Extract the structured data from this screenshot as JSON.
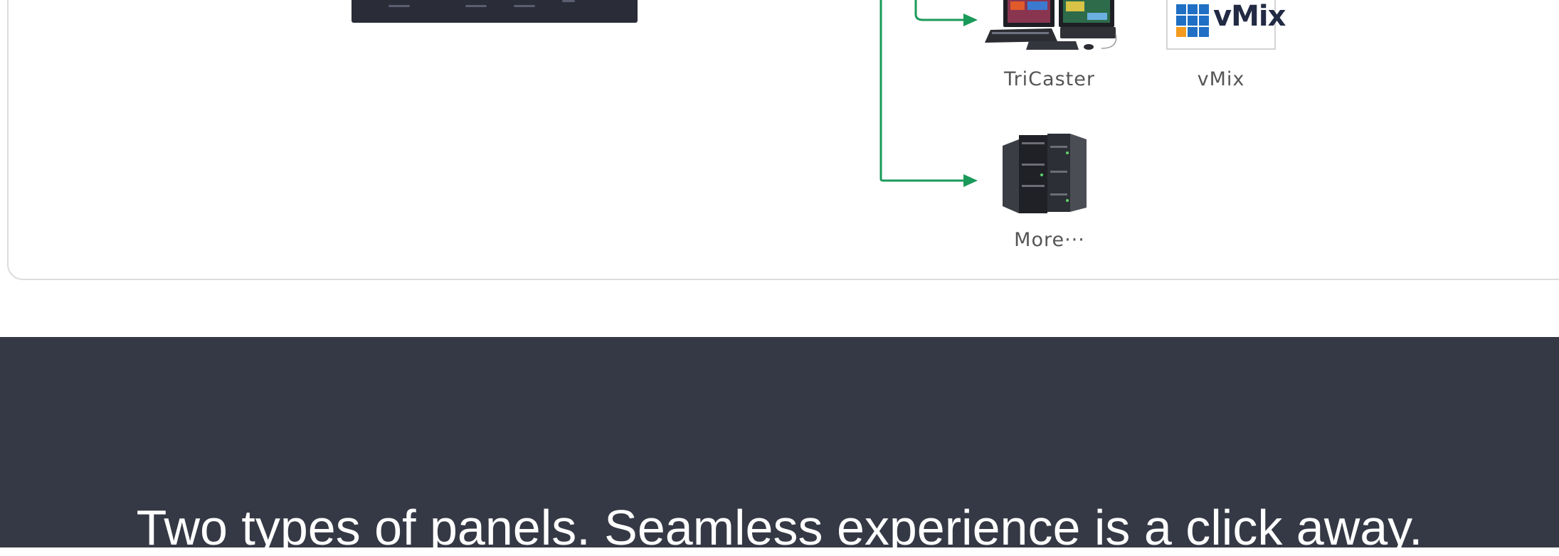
{
  "diagram": {
    "nodes": [
      {
        "id": "tricaster",
        "label": "TriCaster",
        "icon": "tricaster-workstation-icon"
      },
      {
        "id": "vmix",
        "label": "vMix",
        "logo_text": "vMix",
        "icon": "vmix-logo-icon"
      },
      {
        "id": "more",
        "label": "More···",
        "icon": "server-rack-icon"
      }
    ],
    "connector_color": "#1a9a5a"
  },
  "banner": {
    "tagline": "Two types of panels. Seamless experience is a click away."
  },
  "colors": {
    "banner_bg": "#353945",
    "card_border": "#dcdcdc",
    "vmix_blue": "#1f6fc4",
    "vmix_orange": "#f39a1f"
  }
}
